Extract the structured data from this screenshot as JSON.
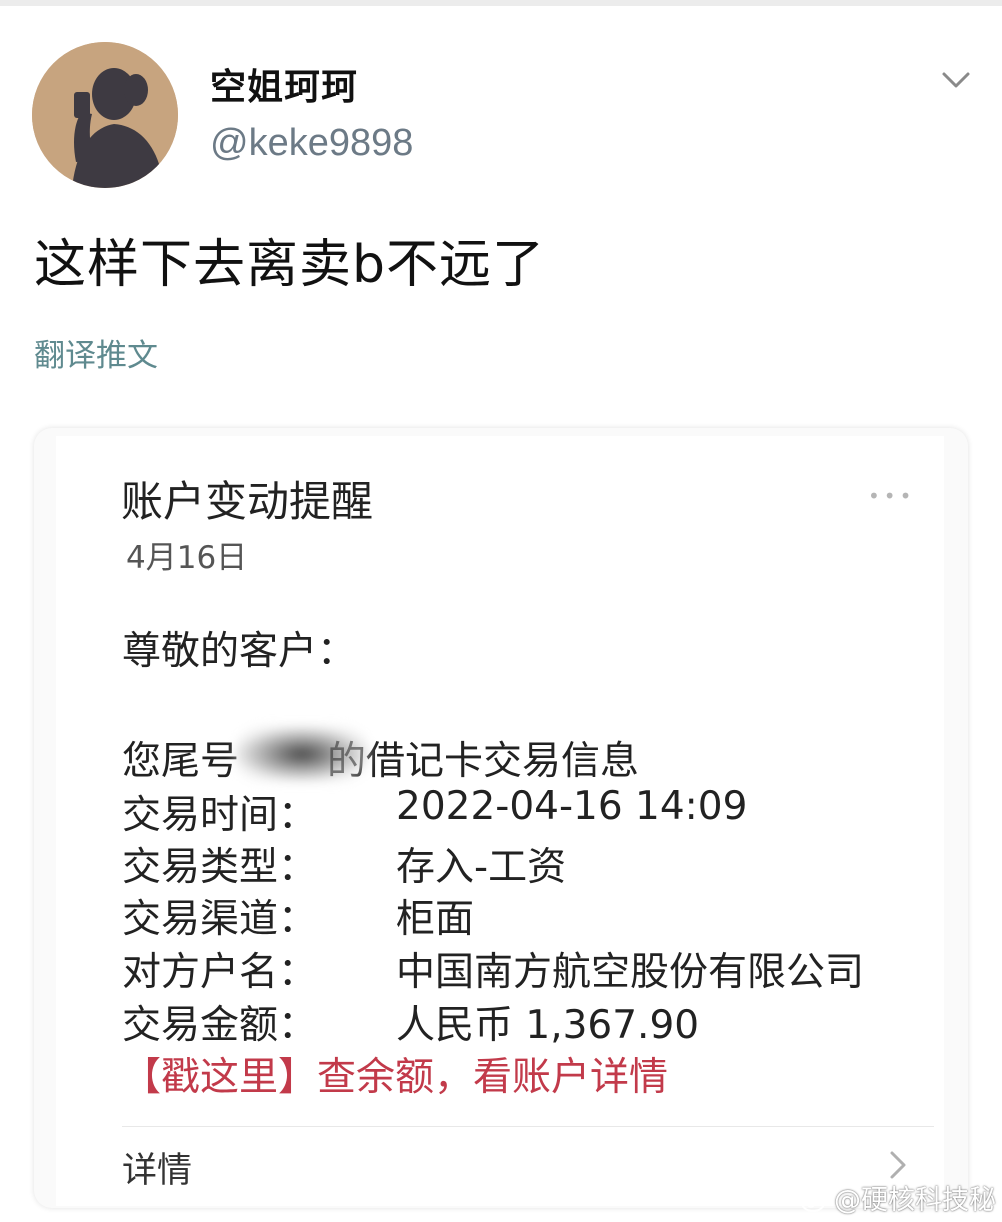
{
  "post": {
    "display_name": "空姐珂珂",
    "handle": "@keke9898",
    "text": "这样下去离卖b不远了",
    "translate_label": "翻译推文"
  },
  "sms": {
    "title": "账户变动提醒",
    "menu_dots": "•••",
    "date": "4月16日",
    "greeting": "尊敬的客户：",
    "line1_prefix": "您尾号",
    "line1_suffix": "的借记卡交易信息",
    "rows": [
      {
        "label": "交易时间：",
        "value": "2022-04-16 14:09"
      },
      {
        "label": "交易类型：",
        "value": "存入-工资"
      },
      {
        "label": "交易渠道：",
        "value": "柜面"
      },
      {
        "label": "对方户名：",
        "value": "中国南方航空股份有限公司"
      },
      {
        "label": "交易金额：",
        "value": "人民币 1,367.90"
      }
    ],
    "link_text": "【戳这里】查余额，看账户详情",
    "details_label": "详情"
  },
  "watermark": {
    "text": "@硬核科技秘"
  },
  "colors": {
    "handle": "#6c7a86",
    "translate_link": "#5f8a8f",
    "link_red": "#c23a4a"
  },
  "icons": {
    "more": "chevron-down-icon",
    "details": "chevron-right-icon",
    "watermark": "weibo-icon"
  }
}
